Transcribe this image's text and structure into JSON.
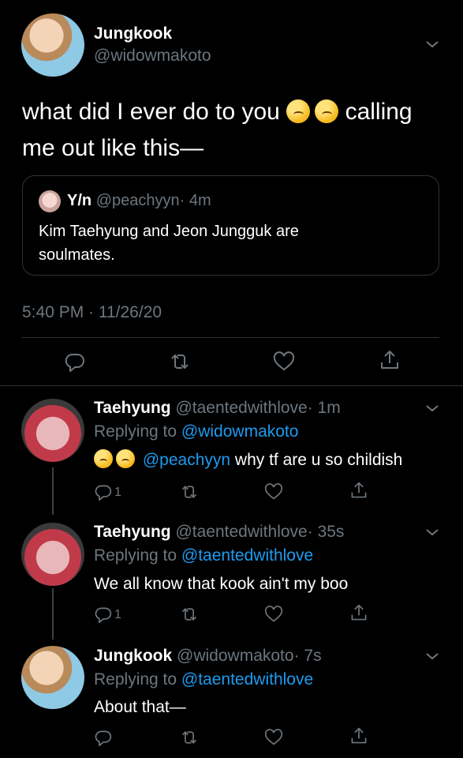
{
  "main_tweet": {
    "name": "Jungkook",
    "handle": "@widowmakoto",
    "text_before": "what did I ever do to you",
    "text_after_emoji": "calling",
    "text_line2": "me out like this—",
    "quoted": {
      "name": "Y/n",
      "handle": "@peachyyn",
      "time": "· 4m",
      "text": "Kim Taehyung and Jeon Jungguk are soulmates."
    },
    "timestamp": "5:40 PM · 11/26/20"
  },
  "replies": [
    {
      "name": "Taehyung",
      "handle": "@taentedwithlove",
      "time": "· 1m",
      "replying_label": "Replying to",
      "replying_to": "@widowmakoto",
      "mention": "@peachyyn",
      "text": "why tf are u so childish",
      "reply_count": "1"
    },
    {
      "name": "Taehyung",
      "handle": "@taentedwithlove",
      "time": "· 35s",
      "replying_label": "Replying to",
      "replying_to": "@taentedwithlove",
      "text": "We all know that kook ain't my boo",
      "reply_count": "1"
    },
    {
      "name": "Jungkook",
      "handle": "@widowmakoto",
      "time": "· 7s",
      "replying_label": "Replying to",
      "replying_to": "@taentedwithlove",
      "text": "About that—"
    }
  ],
  "colors": {
    "background": "#000000",
    "text": "#ffffff",
    "secondary": "#6e767d",
    "link": "#1d9bf0",
    "divider": "#2f3336"
  },
  "icons": [
    "reply-icon",
    "retweet-icon",
    "like-icon",
    "share-icon",
    "chevron-down-icon",
    "worried-face-emoji",
    "eye-roll-emoji"
  ]
}
